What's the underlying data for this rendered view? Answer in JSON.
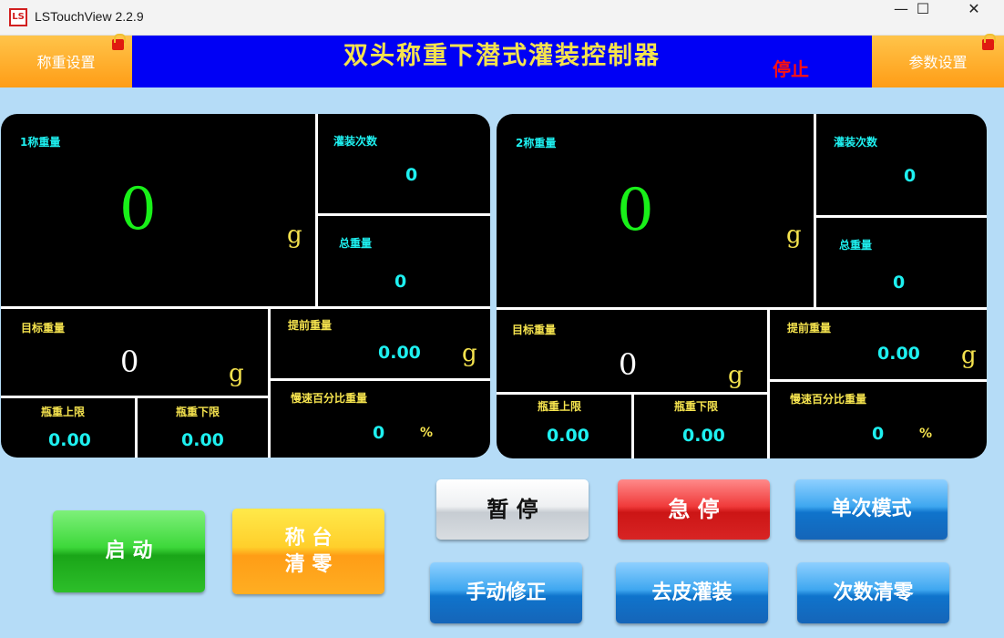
{
  "window": {
    "logo_text": "LS",
    "title": "LSTouchView 2.2.9",
    "min_glyph": "—",
    "max_glyph": "☐",
    "close_glyph": "✕"
  },
  "header": {
    "left_button": "称重设置",
    "title": "双头称重下潜式灌装控制器",
    "status": "停止",
    "right_button": "参数设置",
    "lock_icon_label": "1"
  },
  "panels": [
    {
      "weight_label": "1称重量",
      "weight_value": "0",
      "weight_unit": "g",
      "fill_count_label": "灌装次数",
      "fill_count_value": "0",
      "total_weight_label": "总重量",
      "total_weight_value": "0",
      "target_label": "目标重量",
      "target_value": "0",
      "target_unit": "g",
      "advance_label": "提前重量",
      "advance_value": "0.00",
      "advance_unit": "g",
      "upper_label": "瓶重上限",
      "upper_value": "0.00",
      "lower_label": "瓶重下限",
      "lower_value": "0.00",
      "slow_label": "慢速百分比重量",
      "slow_value": "0",
      "slow_unit": "%"
    },
    {
      "weight_label": "2称重量",
      "weight_value": "0",
      "weight_unit": "g",
      "fill_count_label": "灌装次数",
      "fill_count_value": "0",
      "total_weight_label": "总重量",
      "total_weight_value": "0",
      "target_label": "目标重量",
      "target_value": "0",
      "target_unit": "g",
      "advance_label": "提前重量",
      "advance_value": "0.00",
      "advance_unit": "g",
      "upper_label": "瓶重上限",
      "upper_value": "0.00",
      "lower_label": "瓶重下限",
      "lower_value": "0.00",
      "slow_label": "慢速百分比重量",
      "slow_value": "0",
      "slow_unit": "%"
    }
  ],
  "controls": {
    "start": "启 动",
    "tare_line1": "称 台",
    "tare_line2": "清 零",
    "pause": "暂 停",
    "estop": "急 停",
    "single_mode": "单次模式",
    "manual_correct": "手动修正",
    "tare_fill": "去皮灌装",
    "count_clear": "次数清零"
  },
  "colors": {
    "background": "#b5dcf7",
    "header_blue": "#0000f5",
    "title_yellow": "#f5e34e",
    "status_red": "#ff1010",
    "value_cyan": "#1ef0f0",
    "weight_green": "#19f019"
  }
}
